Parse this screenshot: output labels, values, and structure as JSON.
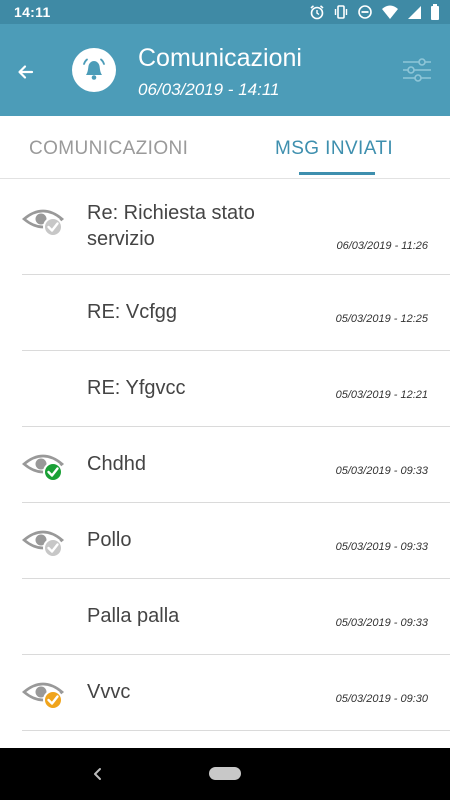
{
  "status_bar": {
    "time": "14:11"
  },
  "header": {
    "title": "Comunicazioni",
    "subtitle": "06/03/2019 - 14:11"
  },
  "tabs": [
    {
      "label": "COMUNICAZIONI",
      "active": false
    },
    {
      "label": "MSG INVIATI",
      "active": true
    }
  ],
  "messages": [
    {
      "subject": "Re: Richiesta stato servizio",
      "date": "06/03/2019 - 11:26",
      "status_icon": "eye-check-icon",
      "status_color": "#c7c7c7"
    },
    {
      "subject": "RE: Vcfgg",
      "date": "05/03/2019 - 12:25",
      "status_icon": "",
      "status_color": ""
    },
    {
      "subject": "RE: Yfgvcc",
      "date": "05/03/2019 - 12:21",
      "status_icon": "",
      "status_color": ""
    },
    {
      "subject": "Chdhd",
      "date": "05/03/2019 - 09:33",
      "status_icon": "eye-check-icon",
      "status_color": "#1aa036"
    },
    {
      "subject": "Pollo",
      "date": "05/03/2019 - 09:33",
      "status_icon": "eye-check-icon",
      "status_color": "#c7c7c7"
    },
    {
      "subject": "Palla palla",
      "date": "05/03/2019 - 09:33",
      "status_icon": "",
      "status_color": ""
    },
    {
      "subject": "Vvvc",
      "date": "05/03/2019 - 09:30",
      "status_icon": "eye-check-icon",
      "status_color": "#f0a41c"
    }
  ],
  "colors": {
    "primary": "#4c9cb8",
    "status_bar": "#3f8aa5",
    "accent": "#3e8fae"
  }
}
